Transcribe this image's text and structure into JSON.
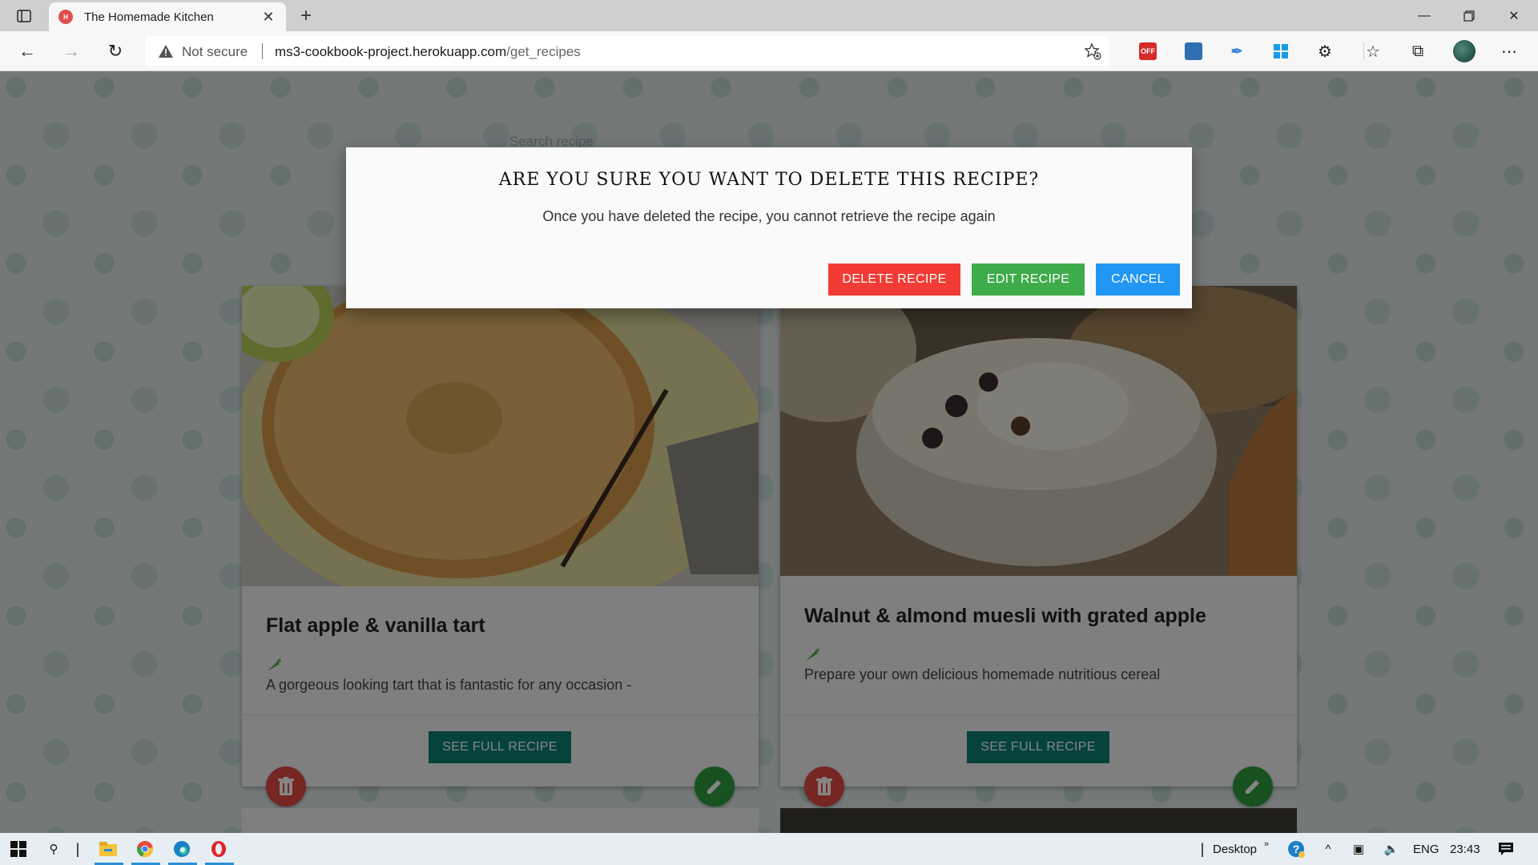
{
  "browser": {
    "tab_title": "The Homemade Kitchen",
    "favicon_text": "H",
    "address": {
      "security": "Not secure",
      "host": "ms3-cookbook-project.herokuapp.com",
      "path": "/get_recipes"
    },
    "extensions": [
      {
        "name": "coupon-extension-icon",
        "label": "OFF",
        "color": "#d62b2b"
      },
      {
        "name": "screenshot-extension-icon",
        "label": "",
        "color": "#2f6fb2"
      },
      {
        "name": "pen-extension-icon",
        "label": "",
        "color": "#3f86d8"
      },
      {
        "name": "windows-extension-icon",
        "label": "",
        "color": "#1a9be6"
      }
    ]
  },
  "page": {
    "search_placeholder": "Search recipe",
    "recipes": [
      {
        "title": "Flat apple & vanilla tart",
        "description": "A gorgeous looking tart that is fantastic for any occasion -",
        "see_label": "SEE FULL RECIPE"
      },
      {
        "title": "Walnut & almond muesli with grated apple",
        "description": "Prepare your own delicious homemade nutritious cereal",
        "see_label": "SEE FULL RECIPE"
      }
    ]
  },
  "modal": {
    "title": "ARE YOU SURE YOU WANT TO DELETE THIS RECIPE?",
    "text": "Once you have deleted the recipe, you cannot retrieve the recipe again",
    "delete_label": "DELETE RECIPE",
    "edit_label": "EDIT RECIPE",
    "cancel_label": "CANCEL"
  },
  "taskbar": {
    "desktop_label": "Desktop",
    "language": "ENG",
    "time": "23:43"
  }
}
